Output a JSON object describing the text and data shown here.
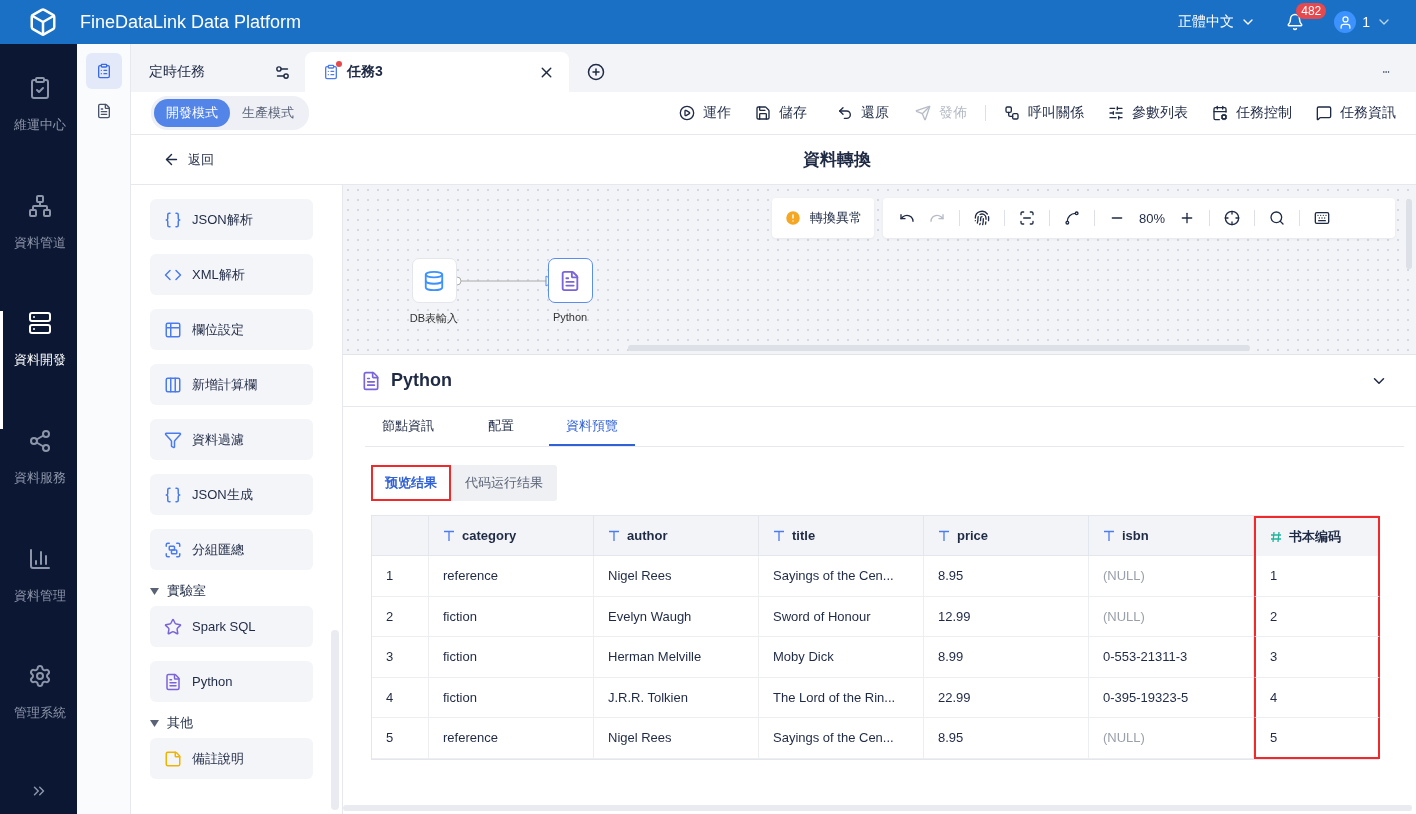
{
  "header": {
    "title": "FineDataLink Data Platform",
    "language": "正體中文",
    "notification_count": "482",
    "user": "1"
  },
  "nav": [
    {
      "label": "維運中心",
      "selected": false
    },
    {
      "label": "資料管道",
      "selected": false
    },
    {
      "label": "資料開發",
      "selected": true
    },
    {
      "label": "資料服務",
      "selected": false
    },
    {
      "label": "資料管理",
      "selected": false
    },
    {
      "label": "管理系統",
      "selected": false
    }
  ],
  "subnav": [
    {
      "selected": true
    },
    {
      "selected": false
    }
  ],
  "tabs": [
    {
      "label": "定時任務",
      "selected": false
    },
    {
      "label": "任務3",
      "selected": true
    }
  ],
  "modes": [
    {
      "label": "開發模式",
      "selected": true
    },
    {
      "label": "生產模式",
      "selected": false
    }
  ],
  "actions": [
    {
      "label": "運作",
      "disabled": false
    },
    {
      "label": "儲存",
      "disabled": false
    },
    {
      "label": "還原",
      "disabled": false
    },
    {
      "label": "發佈",
      "disabled": true
    },
    {
      "label": "呼叫關係",
      "disabled": false
    },
    {
      "label": "參數列表",
      "disabled": false
    },
    {
      "label": "任務控制",
      "disabled": false
    },
    {
      "label": "任務資訊",
      "disabled": false
    }
  ],
  "back": "返回",
  "page_title": "資料轉換",
  "palette": [
    {
      "kind": "item",
      "label": "JSON解析"
    },
    {
      "kind": "item",
      "label": "XML解析"
    },
    {
      "kind": "item",
      "label": "欄位設定"
    },
    {
      "kind": "item",
      "label": "新增計算欄"
    },
    {
      "kind": "item",
      "label": "資料過濾"
    },
    {
      "kind": "item",
      "label": "JSON生成"
    },
    {
      "kind": "item",
      "label": "分組匯總"
    },
    {
      "kind": "group",
      "label": "實驗室",
      "expanded": true
    },
    {
      "kind": "item",
      "label": "Spark SQL"
    },
    {
      "kind": "item",
      "label": "Python"
    },
    {
      "kind": "group",
      "label": "其他",
      "expanded": true
    },
    {
      "kind": "item",
      "label": "備註說明"
    }
  ],
  "canvas": {
    "warning": "轉換異常",
    "zoom": "80%",
    "nodes": [
      {
        "label": "DB表輸入",
        "selected": false
      },
      {
        "label": "Python",
        "selected": true
      }
    ]
  },
  "panel": {
    "title": "Python",
    "tabs": [
      {
        "label": "節點資訊",
        "selected": false
      },
      {
        "label": "配置",
        "selected": false
      },
      {
        "label": "資料預覽",
        "selected": true
      }
    ],
    "subtabs": [
      {
        "label": "预览结果",
        "selected": true,
        "highlighted": true
      },
      {
        "label": "代码运行结果",
        "selected": false,
        "highlighted": false
      }
    ],
    "columns": [
      {
        "label": "category",
        "kind": "text",
        "highlighted": false
      },
      {
        "label": "author",
        "kind": "text",
        "highlighted": false
      },
      {
        "label": "title",
        "kind": "text",
        "highlighted": false
      },
      {
        "label": "price",
        "kind": "text",
        "highlighted": false
      },
      {
        "label": "isbn",
        "kind": "text",
        "highlighted": false
      },
      {
        "label": "书本编码",
        "kind": "number",
        "highlighted": true
      }
    ],
    "rows": [
      {
        "index": "1",
        "cells": [
          "reference",
          "Nigel Rees",
          "Sayings of the Cen...",
          "8.95",
          {
            "text": "(NULL)",
            "muted": true
          },
          "1"
        ]
      },
      {
        "index": "2",
        "cells": [
          "fiction",
          "Evelyn Waugh",
          "Sword of Honour",
          "12.99",
          {
            "text": "(NULL)",
            "muted": true
          },
          "2"
        ]
      },
      {
        "index": "3",
        "cells": [
          "fiction",
          "Herman Melville",
          "Moby Dick",
          "8.99",
          "0-553-21311-3",
          "3"
        ]
      },
      {
        "index": "4",
        "cells": [
          "fiction",
          "J.R.R. Tolkien",
          "The Lord of the Rin...",
          "22.99",
          "0-395-19323-5",
          "4"
        ]
      },
      {
        "index": "5",
        "cells": [
          "reference",
          "Nigel Rees",
          "Sayings of the Cen...",
          "8.95",
          {
            "text": "(NULL)",
            "muted": true
          },
          "5"
        ]
      }
    ]
  }
}
